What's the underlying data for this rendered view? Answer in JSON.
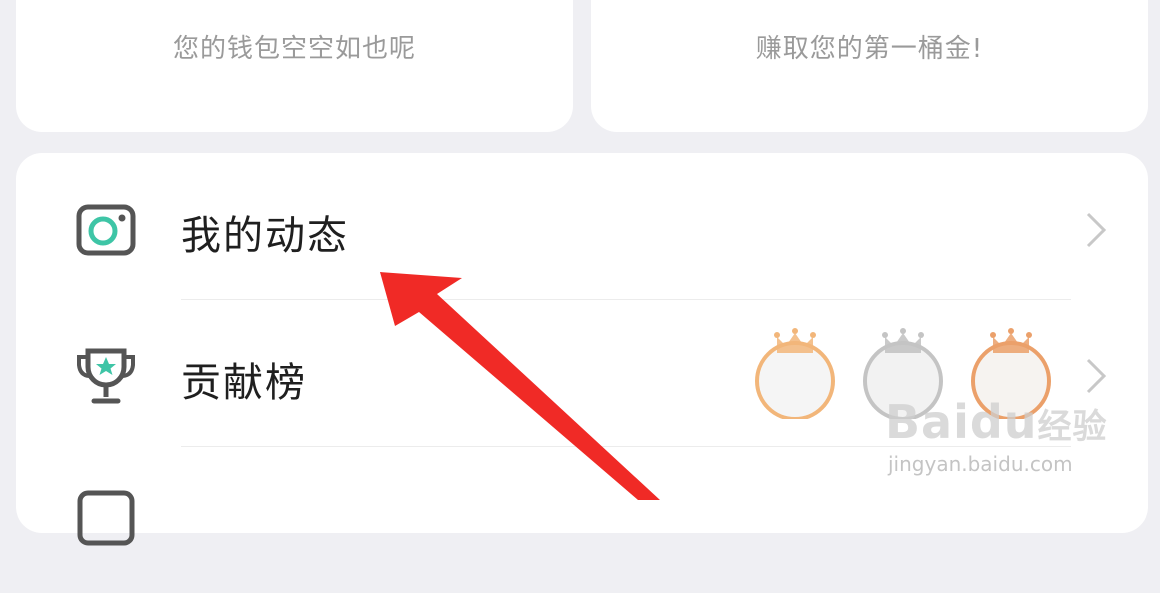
{
  "wallet": {
    "empty_text": "您的钱包空空如也呢"
  },
  "earn": {
    "prompt_text": "赚取您的第一桶金!"
  },
  "menu": {
    "items": [
      {
        "label": "我的动态",
        "icon": "camera-icon"
      },
      {
        "label": "贡献榜",
        "icon": "trophy-icon",
        "ranks": [
          "gold",
          "silver",
          "bronze"
        ]
      }
    ]
  },
  "watermark": {
    "brand": "Baidu",
    "brand_cn": "经验",
    "url": "jingyan.baidu.com"
  },
  "colors": {
    "accent": "#3ec5a6",
    "arrow": "#f02a26",
    "gold": "#f2b67a",
    "silver": "#c4c4c4",
    "bronze": "#eba06a"
  }
}
